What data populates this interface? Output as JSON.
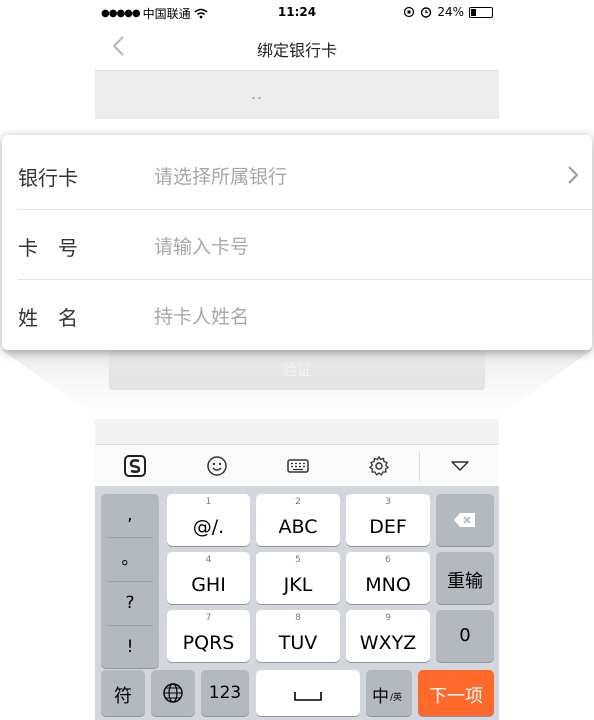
{
  "status_bar": {
    "carrier": "中国联通",
    "time": "11:24",
    "battery": "24%",
    "battery_fraction": 0.24,
    "signal_dots": "●●●●●"
  },
  "nav": {
    "title": "绑定银行卡",
    "back_icon": "chevron-left-icon"
  },
  "form": {
    "rows": [
      {
        "label": "银行卡",
        "placeholder": "请选择所属银行"
      },
      {
        "label": "卡　号",
        "placeholder": "请输入卡号"
      },
      {
        "label": "姓　名",
        "placeholder": "持卡人姓名"
      }
    ]
  },
  "verify_button": {
    "label": "验证"
  },
  "toolbar": {
    "icons": [
      "sogou-logo-icon",
      "emoji-icon",
      "keyboard-icon",
      "settings-icon",
      "collapse-keyboard-icon"
    ]
  },
  "keyboard": {
    "punct": [
      ",",
      "。",
      "?",
      "!"
    ],
    "keys": [
      {
        "num": "1",
        "label": "@/."
      },
      {
        "num": "2",
        "label": "ABC"
      },
      {
        "num": "3",
        "label": "DEF"
      },
      {
        "num": "4",
        "label": "GHI"
      },
      {
        "num": "5",
        "label": "JKL"
      },
      {
        "num": "6",
        "label": "MNO"
      },
      {
        "num": "7",
        "label": "PQRS"
      },
      {
        "num": "8",
        "label": "TUV"
      },
      {
        "num": "9",
        "label": "WXYZ"
      }
    ],
    "retype": "重输",
    "zero": "0",
    "symbols": "符",
    "num_mode": "123",
    "lang_main": "中",
    "lang_sub": "/英",
    "next": "下一项",
    "colors": {
      "accent": "#ff6a2b",
      "bg": "#d3d6dc",
      "dark_key": "#b4b8bf"
    }
  }
}
